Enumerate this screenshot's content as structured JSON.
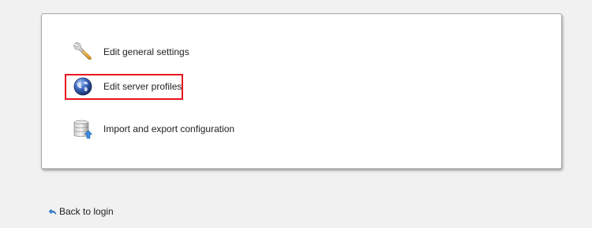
{
  "menu": {
    "items": [
      {
        "label": "Edit general settings",
        "icon": "wrench-icon"
      },
      {
        "label": "Edit server profiles",
        "icon": "globe-icon",
        "highlighted": true
      },
      {
        "label": "Import and export configuration",
        "icon": "database-import-icon"
      }
    ]
  },
  "footer": {
    "back_label": "Back to login",
    "back_icon": "return-arrow-icon"
  },
  "colors": {
    "background": "#f1f1f1",
    "panel": "#ffffff",
    "highlight": "#e8141e",
    "globe": "#2b4f9e",
    "wrench": "#f0a828"
  }
}
